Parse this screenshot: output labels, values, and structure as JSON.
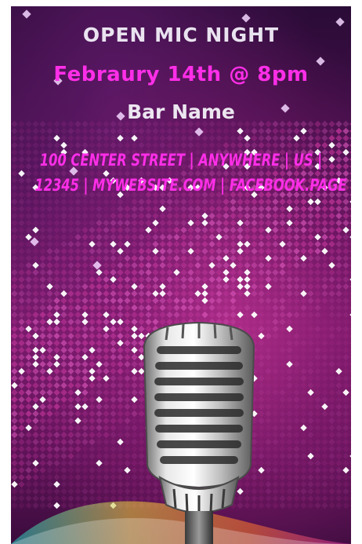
{
  "poster": {
    "title": "OPEN MIC NIGHT",
    "date_time": "Febraury 14th @ 8pm",
    "venue": "Bar Name",
    "address_line_1": "100 CENTER STREET | ANYWHERE | US |",
    "address_line_2": "12345 | MYWEBSITE.COM | FACEBOOK.PAGE"
  },
  "colors": {
    "accent_pink": "#ff2ee8",
    "text_light": "#ece6f0",
    "background_dark": "#2a0b36"
  },
  "decor": {
    "microphone": "microphone-icon",
    "background": "sparkle-dots-pattern"
  }
}
